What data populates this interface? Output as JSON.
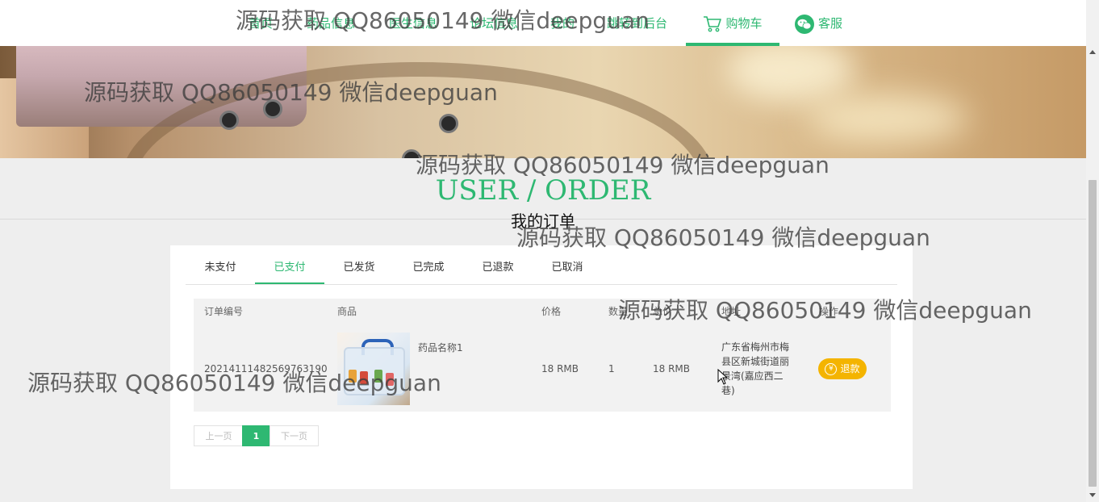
{
  "nav": {
    "items": [
      {
        "label": "首页"
      },
      {
        "label": "药品信息"
      },
      {
        "label": "医生信息"
      },
      {
        "label": "论坛信息"
      },
      {
        "label": "我的"
      },
      {
        "label": "跳转到后台"
      }
    ],
    "cart_label": "购物车",
    "service_label": "客服",
    "accent": "#2eb872"
  },
  "page": {
    "title_en": "USER / ORDER",
    "title_cn": "我的订单"
  },
  "tabs": [
    {
      "label": "未支付",
      "active": false
    },
    {
      "label": "已支付",
      "active": true
    },
    {
      "label": "已发货",
      "active": false
    },
    {
      "label": "已完成",
      "active": false
    },
    {
      "label": "已退款",
      "active": false
    },
    {
      "label": "已取消",
      "active": false
    }
  ],
  "table": {
    "headers": {
      "order_no": "订单编号",
      "product": "商品",
      "price": "价格",
      "qty": "数量",
      "total": "总价",
      "address": "地址",
      "action": "操作"
    },
    "rows": [
      {
        "order_no": "20214111482569763190",
        "product_name": "药品名称1",
        "price": "18 RMB",
        "qty": "1",
        "total": "18 RMB",
        "address": "广东省梅州市梅县区新城街道丽景湾(嘉应西二巷)",
        "action_label": "退款"
      }
    ]
  },
  "pager": {
    "prev": "上一页",
    "current": "1",
    "next": "下一页"
  },
  "watermark": "源码获取 QQ86050149 微信deepguan"
}
